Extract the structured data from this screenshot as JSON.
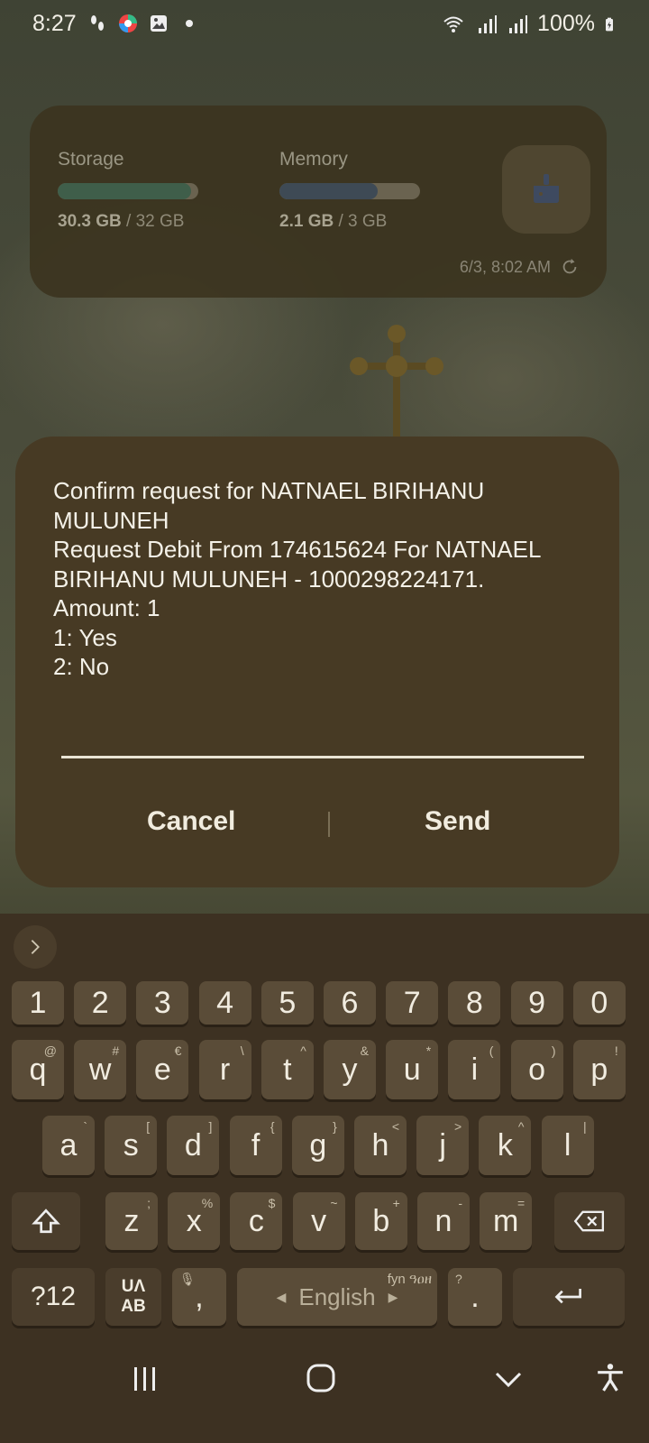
{
  "status_bar": {
    "time": "8:27",
    "battery": "100%"
  },
  "widget": {
    "storage_label": "Storage",
    "storage_used": "30.3 GB",
    "storage_total": " / 32 GB",
    "storage_fraction": 0.95,
    "memory_label": "Memory",
    "memory_used": "2.1 GB",
    "memory_total": " / 3 GB",
    "memory_fraction": 0.7,
    "updated": "6/3, 8:02 AM",
    "colors": {
      "storage_fill": "#3f5e4a",
      "memory_fill": "#3e4a55"
    }
  },
  "dialog": {
    "lines": [
      "Confirm request for NATNAEL BIRIHANU MULUNEH",
      "Request Debit From 174615624 For NATNAEL BIRIHANU MULUNEH - 1000298224171.",
      "Amount: 1",
      "1: Yes",
      "2: No"
    ],
    "input_value": "",
    "cancel_label": "Cancel",
    "send_label": "Send"
  },
  "keyboard": {
    "number_row": [
      "1",
      "2",
      "3",
      "4",
      "5",
      "6",
      "7",
      "8",
      "9",
      "0"
    ],
    "row1": [
      {
        "k": "q",
        "h": "@"
      },
      {
        "k": "w",
        "h": "#"
      },
      {
        "k": "e",
        "h": "€"
      },
      {
        "k": "r",
        "h": "\\"
      },
      {
        "k": "t",
        "h": "^"
      },
      {
        "k": "y",
        "h": "&"
      },
      {
        "k": "u",
        "h": "*"
      },
      {
        "k": "i",
        "h": "("
      },
      {
        "k": "o",
        "h": ")"
      },
      {
        "k": "p",
        "h": "!"
      }
    ],
    "row2": [
      {
        "k": "a",
        "h": "`"
      },
      {
        "k": "s",
        "h": "["
      },
      {
        "k": "d",
        "h": "]"
      },
      {
        "k": "f",
        "h": "{"
      },
      {
        "k": "g",
        "h": "}"
      },
      {
        "k": "h",
        "h": "<"
      },
      {
        "k": "j",
        "h": ">"
      },
      {
        "k": "k",
        "h": "^"
      },
      {
        "k": "l",
        "h": "|"
      }
    ],
    "row3": [
      {
        "k": "z",
        "h": ";"
      },
      {
        "k": "x",
        "h": "%"
      },
      {
        "k": "c",
        "h": "$"
      },
      {
        "k": "v",
        "h": "~"
      },
      {
        "k": "b",
        "h": "+"
      },
      {
        "k": "n",
        "h": "-"
      },
      {
        "k": "m",
        "h": "="
      }
    ],
    "symbols_label": "?12",
    "lang_switch_top": "UΛ",
    "lang_switch_bottom": "AB",
    "comma": ",",
    "space_label": "English",
    "space_hint": "fyn ዓዐዘ",
    "period": ".",
    "period_hint": "?"
  }
}
